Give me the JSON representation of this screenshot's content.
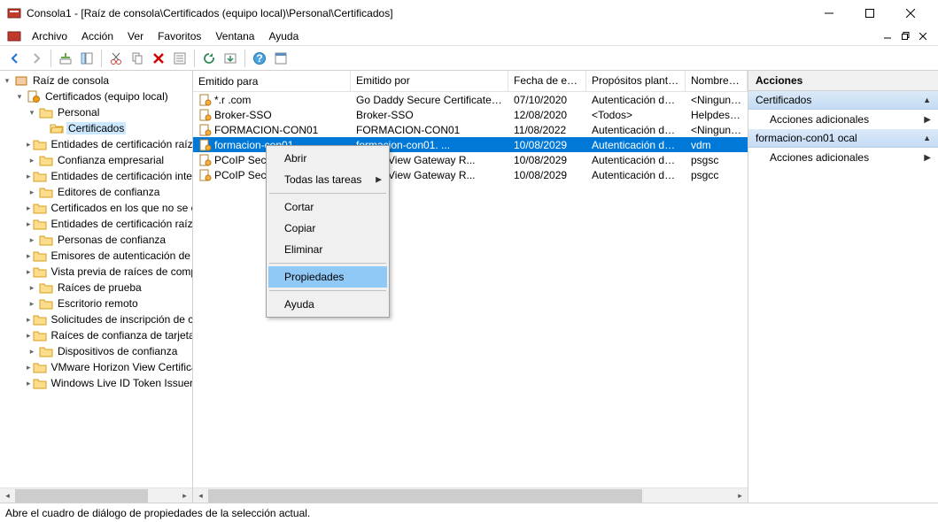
{
  "title": "Consola1 - [Raíz de consola\\Certificados (equipo local)\\Personal\\Certificados]",
  "menubar": [
    "Archivo",
    "Acción",
    "Ver",
    "Favoritos",
    "Ventana",
    "Ayuda"
  ],
  "tree": {
    "root": "Raíz de consola",
    "cert_root": "Certificados (equipo local)",
    "personal": "Personal",
    "certificados": "Certificados",
    "stores": [
      "Entidades de certificación raíz de c",
      "Confianza empresarial",
      "Entidades de certificación intermed",
      "Editores de confianza",
      "Certificados en los que no se confí",
      "Entidades de certificación raíz de t",
      "Personas de confianza",
      "Emisores de autenticación de clien",
      "Vista previa de raíces de compilaci",
      "Raíces de prueba",
      "Escritorio remoto",
      "Solicitudes de inscripción de certifi",
      "Raíces de confianza de tarjetas inte",
      "Dispositivos de confianza",
      "VMware Horizon View Certificates",
      "Windows Live ID Token Issuer"
    ]
  },
  "columns": [
    "Emitido para",
    "Emitido por",
    "Fecha de expir...",
    "Propósitos plantea...",
    "Nombre desc"
  ],
  "rows": [
    {
      "issued_to": "*.r       .com",
      "issued_by": "Go Daddy Secure Certificate Auth...",
      "expires": "07/10/2020",
      "purposes": "Autenticación del s...",
      "friendly": "<Ninguno>"
    },
    {
      "issued_to": "Broker-SSO",
      "issued_by": "Broker-SSO",
      "expires": "12/08/2020",
      "purposes": "<Todos>",
      "friendly": "Helpdesk-key"
    },
    {
      "issued_to": "FORMACION-CON01",
      "issued_by": "FORMACION-CON01",
      "expires": "11/08/2022",
      "purposes": "Autenticación del s...",
      "friendly": "<Ninguno>"
    },
    {
      "issued_to": "formacion-con01                    ",
      "issued_by": "formacion-con01.                      ...",
      "expires": "10/08/2029",
      "purposes": "Autenticación del s...",
      "friendly": "vdm",
      "selected": true
    },
    {
      "issued_to": "PCoIP Securi",
      "issued_by": "orizon View Gateway R...",
      "expires": "10/08/2029",
      "purposes": "Autenticación del s...",
      "friendly": "psgsc"
    },
    {
      "issued_to": "PCoIP Securi",
      "issued_by": "orizon View Gateway R...",
      "expires": "10/08/2029",
      "purposes": "Autenticación del c...",
      "friendly": "psgcc"
    }
  ],
  "context_menu": {
    "abrir": "Abrir",
    "todas_tareas": "Todas las tareas",
    "cortar": "Cortar",
    "copiar": "Copiar",
    "eliminar": "Eliminar",
    "propiedades": "Propiedades",
    "ayuda": "Ayuda"
  },
  "actions": {
    "header": "Acciones",
    "group1": "Certificados",
    "item1": "Acciones adicionales",
    "group2": "formacion-con01                            ocal",
    "item2": "Acciones adicionales"
  },
  "statusbar": "Abre el cuadro de diálogo de propiedades de la selección actual."
}
